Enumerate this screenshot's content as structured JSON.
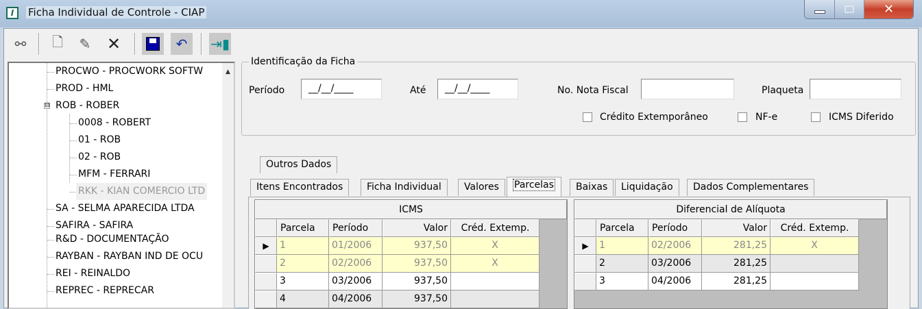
{
  "window": {
    "title": "Ficha Individual de Controle - CIAP",
    "app_icon": "I"
  },
  "toolbar": {
    "icons": [
      "binoculars-icon",
      "new-document-icon",
      "edit-icon",
      "delete-icon",
      "save-icon",
      "undo-icon",
      "exit-door-icon"
    ]
  },
  "tree": {
    "items": [
      {
        "label": "PROCWO - PROCWORK SOFTW"
      },
      {
        "label": "PROD - HML"
      },
      {
        "label": "ROB - ROBER",
        "expander": "⊟"
      },
      {
        "label": "0008 - ROBERT"
      },
      {
        "label": "01 - ROB"
      },
      {
        "label": "02 - ROB"
      },
      {
        "label": "MFM - FERRARI"
      },
      {
        "label": "RKK - KIAN COMERCIO LTD"
      },
      {
        "label": "SA - SELMA APARECIDA LTDA"
      },
      {
        "label": "SAFIRA - SAFIRA"
      },
      {
        "label": "R&D - DOCUMENTAÇÃO"
      },
      {
        "label": "RAYBAN - RAYBAN IND DE OCU"
      },
      {
        "label": "REI - REINALDO"
      },
      {
        "label": "REPREC - REPRECAR"
      }
    ]
  },
  "form": {
    "legend": "Identificação da Ficha",
    "periodo_label": "Período",
    "periodo_value": "__/__/____",
    "ate_label": "Até",
    "ate_value": "__/__/____",
    "nf_label": "No. Nota Fiscal",
    "nf_value": "",
    "plaqueta_label": "Plaqueta",
    "plaqueta_value": "",
    "chk_credito": "Crédito Extemporâneo",
    "chk_nfe": "NF-e",
    "chk_icms": "ICMS Diferido"
  },
  "tabs": {
    "top": "Outros Dados",
    "row": [
      "Itens Encontrados",
      "Ficha Individual",
      "Valores",
      "Parcelas",
      "Baixas",
      "Liquidação",
      "Dados Complementares"
    ],
    "active": "Parcelas"
  },
  "icms": {
    "title": "ICMS",
    "headers": [
      "Parcela",
      "Período",
      "Valor",
      "Créd. Extemp."
    ],
    "rows": [
      [
        "1",
        "01/2006",
        "937,50",
        "X"
      ],
      [
        "2",
        "02/2006",
        "937,50",
        "X"
      ],
      [
        "3",
        "03/2006",
        "937,50",
        ""
      ],
      [
        "4",
        "04/2006",
        "937,50",
        ""
      ]
    ]
  },
  "dif": {
    "title": "Diferencial de Alíquota",
    "headers": [
      "Parcela",
      "Período",
      "Valor",
      "Créd. Extemp."
    ],
    "rows": [
      [
        "1",
        "02/2006",
        "281,25",
        "X"
      ],
      [
        "2",
        "03/2006",
        "281,25",
        ""
      ],
      [
        "3",
        "04/2006",
        "281,25",
        ""
      ]
    ]
  },
  "colors": {
    "highlight_row": "#ffffcc",
    "close_button": "#c7412a"
  }
}
